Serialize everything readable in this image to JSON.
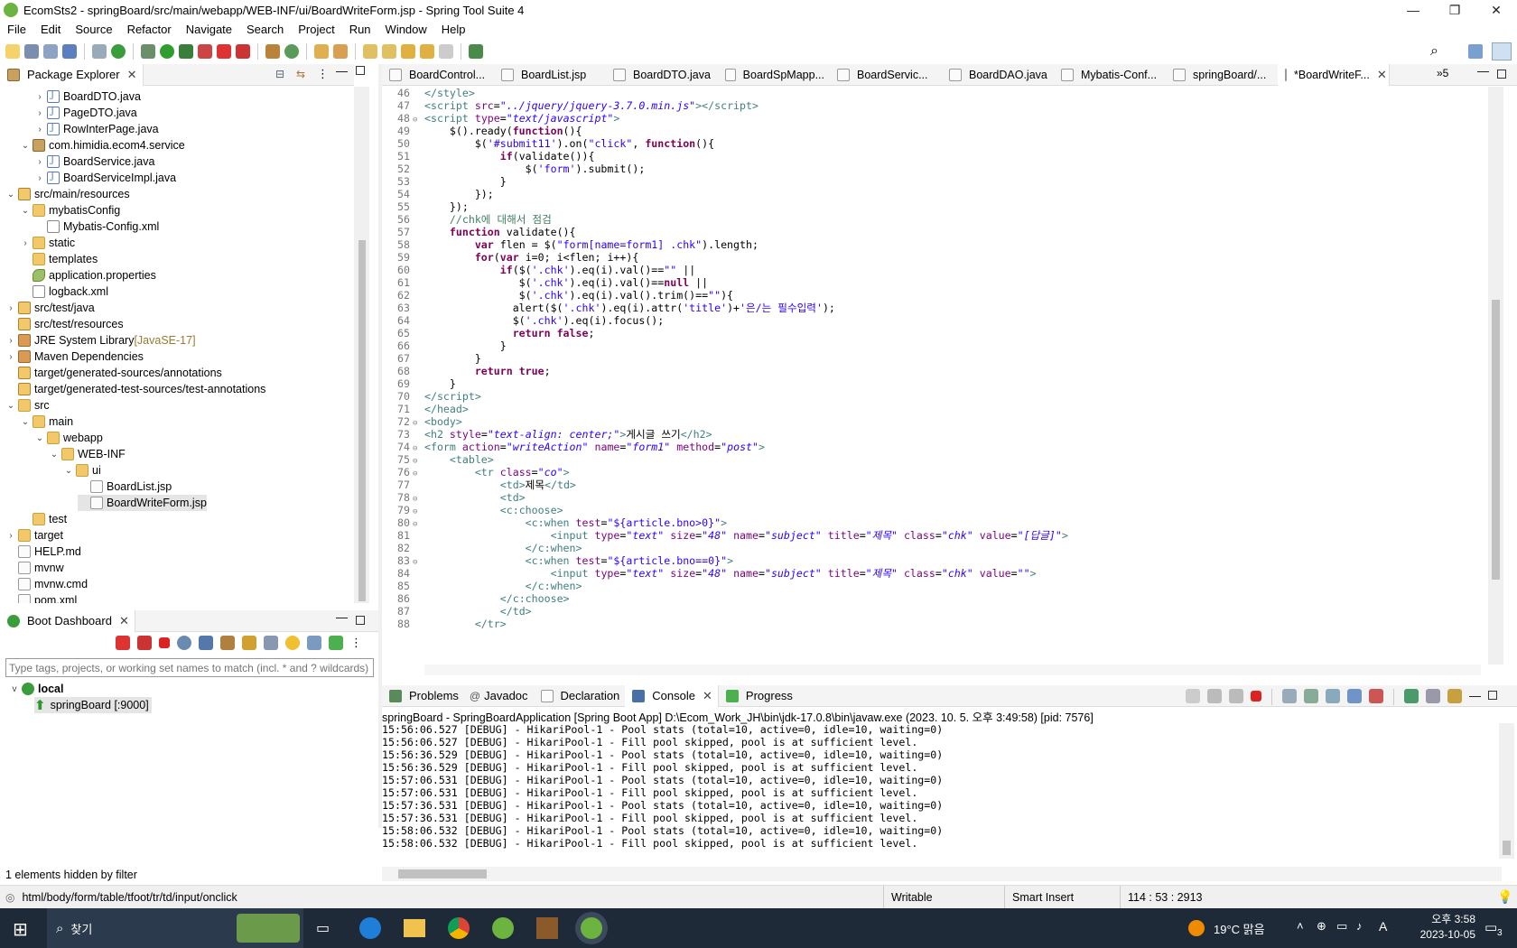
{
  "window": {
    "title": "EcomSts2 - springBoard/src/main/webapp/WEB-INF/ui/BoardWriteForm.jsp - Spring Tool Suite 4",
    "minimize": "—",
    "maximize": "❐",
    "close": "✕"
  },
  "menu": [
    "File",
    "Edit",
    "Source",
    "Refactor",
    "Navigate",
    "Search",
    "Project",
    "Run",
    "Window",
    "Help"
  ],
  "package_explorer": {
    "tab": "Package Explorer",
    "items": [
      {
        "label": "BoardDTO.java",
        "indent": 3,
        "twisty": ">",
        "icon": "java"
      },
      {
        "label": "PageDTO.java",
        "indent": 3,
        "twisty": ">",
        "icon": "java"
      },
      {
        "label": "RowInterPage.java",
        "indent": 3,
        "twisty": ">",
        "icon": "java"
      },
      {
        "label": "com.himidia.ecom4.service",
        "indent": 2,
        "twisty": "v",
        "icon": "pkg"
      },
      {
        "label": "BoardService.java",
        "indent": 3,
        "twisty": ">",
        "icon": "java"
      },
      {
        "label": "BoardServiceImpl.java",
        "indent": 3,
        "twisty": ">",
        "icon": "java"
      },
      {
        "label": "src/main/resources",
        "indent": 1,
        "twisty": "v",
        "icon": "src"
      },
      {
        "label": "mybatisConfig",
        "indent": 2,
        "twisty": "v",
        "icon": "folder"
      },
      {
        "label": "Mybatis-Config.xml",
        "indent": 3,
        "twisty": "",
        "icon": "xml"
      },
      {
        "label": "static",
        "indent": 2,
        "twisty": ">",
        "icon": "folder"
      },
      {
        "label": "templates",
        "indent": 2,
        "twisty": "",
        "icon": "folder"
      },
      {
        "label": "application.properties",
        "indent": 2,
        "twisty": "",
        "icon": "prop"
      },
      {
        "label": "logback.xml",
        "indent": 2,
        "twisty": "",
        "icon": "xml"
      },
      {
        "label": "src/test/java",
        "indent": 1,
        "twisty": ">",
        "icon": "src"
      },
      {
        "label": "src/test/resources",
        "indent": 1,
        "twisty": "",
        "icon": "src"
      },
      {
        "label": "JRE System Library",
        "extra": "[JavaSE-17]",
        "indent": 1,
        "twisty": ">",
        "icon": "lib"
      },
      {
        "label": "Maven Dependencies",
        "indent": 1,
        "twisty": ">",
        "icon": "lib"
      },
      {
        "label": "target/generated-sources/annotations",
        "indent": 1,
        "twisty": "",
        "icon": "src"
      },
      {
        "label": "target/generated-test-sources/test-annotations",
        "indent": 1,
        "twisty": "",
        "icon": "src"
      },
      {
        "label": "src",
        "indent": 1,
        "twisty": "v",
        "icon": "folder"
      },
      {
        "label": "main",
        "indent": 2,
        "twisty": "v",
        "icon": "folder"
      },
      {
        "label": "webapp",
        "indent": 3,
        "twisty": "v",
        "icon": "folder"
      },
      {
        "label": "WEB-INF",
        "indent": 4,
        "twisty": "v",
        "icon": "folder"
      },
      {
        "label": "ui",
        "indent": 5,
        "twisty": "v",
        "icon": "folder"
      },
      {
        "label": "BoardList.jsp",
        "indent": 6,
        "twisty": "",
        "icon": "file"
      },
      {
        "label": "BoardWriteForm.jsp",
        "indent": 6,
        "twisty": "",
        "icon": "file",
        "selected": true
      },
      {
        "label": "test",
        "indent": 2,
        "twisty": "",
        "icon": "folder"
      },
      {
        "label": "target",
        "indent": 1,
        "twisty": ">",
        "icon": "folder"
      },
      {
        "label": "HELP.md",
        "indent": 1,
        "twisty": "",
        "icon": "file"
      },
      {
        "label": "mvnw",
        "indent": 1,
        "twisty": "",
        "icon": "file"
      },
      {
        "label": "mvnw.cmd",
        "indent": 1,
        "twisty": "",
        "icon": "file"
      },
      {
        "label": "pom.xml",
        "indent": 1,
        "twisty": "",
        "icon": "file"
      }
    ]
  },
  "boot_dashboard": {
    "tab": "Boot Dashboard",
    "filter_placeholder": "Type tags, projects, or working set names to match (incl. * and ? wildcards)",
    "local": "local",
    "app": "springBoard [:9000]",
    "footer": "1 elements hidden by filter"
  },
  "editor_tabs": [
    {
      "label": "BoardControl..."
    },
    {
      "label": "BoardList.jsp"
    },
    {
      "label": "BoardDTO.java"
    },
    {
      "label": "BoardSpMapp..."
    },
    {
      "label": "BoardServic..."
    },
    {
      "label": "BoardDAO.java"
    },
    {
      "label": "Mybatis-Conf..."
    },
    {
      "label": "springBoard/..."
    },
    {
      "label": "*BoardWriteF...",
      "active": true
    }
  ],
  "editor_overflow": "»5",
  "code": [
    {
      "n": "46",
      "h": "<span class='tag'>&lt;/style&gt;</span>"
    },
    {
      "n": "47",
      "h": "<span class='tag'>&lt;script</span> <span class='att'>src</span>=<span class='str'>\"../jquery/jquery-3.7.0.min.js\"</span><span class='tag'>&gt;&lt;/script&gt;</span>"
    },
    {
      "n": "48",
      "f": "⊖",
      "h": "<span class='tag'>&lt;script</span> <span class='att'>type</span>=<span class='str'>\"text/javascript\"</span><span class='tag'>&gt;</span>"
    },
    {
      "n": "49",
      "h": "    $().ready(<span class='kw'>function</span>(){"
    },
    {
      "n": "50",
      "h": "        $(<span class='jstr'>'#submit11'</span>).on(<span class='jstr'>\"click\"</span>, <span class='kw'>function</span>(){"
    },
    {
      "n": "51",
      "h": "            <span class='kw'>if</span>(validate()){"
    },
    {
      "n": "52",
      "h": "                $(<span class='jstr'>'form'</span>).submit();"
    },
    {
      "n": "53",
      "h": "            }"
    },
    {
      "n": "54",
      "h": "        });"
    },
    {
      "n": "55",
      "h": "    });"
    },
    {
      "n": "56",
      "h": "    <span class='cm'>//chk에 대해서 점검</span>"
    },
    {
      "n": "57",
      "h": "    <span class='kw'>function</span> validate(){"
    },
    {
      "n": "58",
      "h": "        <span class='kw'>var</span> flen = $(<span class='jstr'>\"form[name=form1] .chk\"</span>).length;"
    },
    {
      "n": "59",
      "h": "        <span class='kw'>for</span>(<span class='kw'>var</span> i=0; i&lt;flen; i++){"
    },
    {
      "n": "60",
      "h": "            <span class='kw'>if</span>($(<span class='jstr'>'.chk'</span>).eq(i).val()==<span class='jstr'>\"\"</span> ||"
    },
    {
      "n": "61",
      "h": "               $(<span class='jstr'>'.chk'</span>).eq(i).val()==<span class='kw'>null</span> ||"
    },
    {
      "n": "62",
      "h": "               $(<span class='jstr'>'.chk'</span>).eq(i).val().trim()==<span class='jstr'>\"\"</span>){"
    },
    {
      "n": "63",
      "h": "              alert($(<span class='jstr'>'.chk'</span>).eq(i).attr(<span class='jstr'>'title'</span>)+<span class='jstr'>'은/는 필수입력'</span>);"
    },
    {
      "n": "64",
      "h": "              $(<span class='jstr'>'.chk'</span>).eq(i).focus();"
    },
    {
      "n": "65",
      "h": "              <span class='kw'>return</span> <span class='kw'>false</span>;"
    },
    {
      "n": "66",
      "h": "            }"
    },
    {
      "n": "67",
      "h": "        }"
    },
    {
      "n": "68",
      "h": "        <span class='kw'>return</span> <span class='kw'>true</span>;"
    },
    {
      "n": "69",
      "h": "    }"
    },
    {
      "n": "70",
      "h": "<span class='tag'>&lt;/script&gt;</span>"
    },
    {
      "n": "71",
      "h": "<span class='tag'>&lt;/head&gt;</span>"
    },
    {
      "n": "72",
      "f": "⊖",
      "h": "<span class='tag'>&lt;body&gt;</span>"
    },
    {
      "n": "73",
      "h": "<span class='tag'>&lt;h2</span> <span class='att'>style</span>=<span class='str'>\"text-align: center;\"</span><span class='tag'>&gt;</span>게시글 쓰기<span class='tag'>&lt;/h2&gt;</span>"
    },
    {
      "n": "74",
      "f": "⊖",
      "h": "<span class='tag'>&lt;form</span> <span class='att'>action</span>=<span class='str'>\"writeAction\"</span> <span class='att'>name</span>=<span class='str'>\"form1\"</span> <span class='att'>method</span>=<span class='str'>\"post\"</span><span class='tag'>&gt;</span>"
    },
    {
      "n": "75",
      "f": "⊖",
      "h": "    <span class='tag'>&lt;table&gt;</span>"
    },
    {
      "n": "76",
      "f": "⊖",
      "h": "        <span class='tag'>&lt;tr</span> <span class='att'>class</span>=<span class='str'>\"co\"</span><span class='tag'>&gt;</span>"
    },
    {
      "n": "77",
      "h": "            <span class='tag'>&lt;td&gt;</span>제목<span class='tag'>&lt;/td&gt;</span>"
    },
    {
      "n": "78",
      "f": "⊖",
      "h": "            <span class='tag'>&lt;td&gt;</span>"
    },
    {
      "n": "79",
      "f": "⊖",
      "h": "            <span class='tag'>&lt;c:choose&gt;</span>"
    },
    {
      "n": "80",
      "f": "⊖",
      "h": "                <span class='tag'>&lt;c:when</span> <span class='att'>test</span>=<span class='jstr'>\"${article.bno&gt;0}\"</span><span class='tag'>&gt;</span>"
    },
    {
      "n": "81",
      "h": "                    <span class='tag'>&lt;input</span> <span class='att'>type</span>=<span class='str'>\"text\"</span> <span class='att'>size</span>=<span class='str'>\"48\"</span> <span class='att'>name</span>=<span class='str'>\"subject\"</span> <span class='att'>title</span>=<span class='str'>\"제목\"</span> <span class='att'>class</span>=<span class='str'>\"chk\"</span> <span class='att'>value</span>=<span class='str'>\"[답글]\"</span><span class='tag'>&gt;</span>"
    },
    {
      "n": "82",
      "h": "                <span class='tag'>&lt;/c:when&gt;</span>"
    },
    {
      "n": "83",
      "f": "⊖",
      "h": "                <span class='tag'>&lt;c:when</span> <span class='att'>test</span>=<span class='jstr'>\"${article.bno==0}\"</span><span class='tag'>&gt;</span>"
    },
    {
      "n": "84",
      "h": "                    <span class='tag'>&lt;input</span> <span class='att'>type</span>=<span class='str'>\"text\"</span> <span class='att'>size</span>=<span class='str'>\"48\"</span> <span class='att'>name</span>=<span class='str'>\"subject\"</span> <span class='att'>title</span>=<span class='str'>\"제목\"</span> <span class='att'>class</span>=<span class='str'>\"chk\"</span> <span class='att'>value</span>=<span class='str'>\"\"</span><span class='tag'>&gt;</span>"
    },
    {
      "n": "85",
      "h": "                <span class='tag'>&lt;/c:when&gt;</span>"
    },
    {
      "n": "86",
      "h": "            <span class='tag'>&lt;/c:choose&gt;</span>"
    },
    {
      "n": "87",
      "h": "            <span class='tag'>&lt;/td&gt;</span>"
    },
    {
      "n": "88",
      "h": "        <span class='tag'>&lt;/tr&gt;</span>"
    }
  ],
  "bottom_tabs": [
    "Problems",
    "Javadoc",
    "Declaration",
    "Console",
    "Progress"
  ],
  "console_header": "springBoard - SpringBoardApplication [Spring Boot App] D:\\Ecom_Work_JH\\bin\\jdk-17.0.8\\bin\\javaw.exe  (2023. 10. 5. 오후 3:49:58) [pid: 7576]",
  "console_lines": [
    "15:56:06.527 [DEBUG] - HikariPool-1 - Pool stats (total=10, active=0, idle=10, waiting=0)",
    "15:56:06.527 [DEBUG] - HikariPool-1 - Fill pool skipped, pool is at sufficient level.",
    "15:56:36.529 [DEBUG] - HikariPool-1 - Pool stats (total=10, active=0, idle=10, waiting=0)",
    "15:56:36.529 [DEBUG] - HikariPool-1 - Fill pool skipped, pool is at sufficient level.",
    "15:57:06.531 [DEBUG] - HikariPool-1 - Pool stats (total=10, active=0, idle=10, waiting=0)",
    "15:57:06.531 [DEBUG] - HikariPool-1 - Fill pool skipped, pool is at sufficient level.",
    "15:57:36.531 [DEBUG] - HikariPool-1 - Pool stats (total=10, active=0, idle=10, waiting=0)",
    "15:57:36.531 [DEBUG] - HikariPool-1 - Fill pool skipped, pool is at sufficient level.",
    "15:58:06.532 [DEBUG] - HikariPool-1 - Pool stats (total=10, active=0, idle=10, waiting=0)",
    "15:58:06.532 [DEBUG] - HikariPool-1 - Fill pool skipped, pool is at sufficient level."
  ],
  "status": {
    "path": "html/body/form/table/tfoot/tr/td/input/onclick",
    "writable": "Writable",
    "insert": "Smart Insert",
    "position": "114 : 53 : 2913"
  },
  "taskbar": {
    "search": "찾기",
    "weather": "19°C 맑음",
    "ime": "A",
    "time": "오후 3:58",
    "date": "2023-10-05",
    "notif": "3"
  }
}
